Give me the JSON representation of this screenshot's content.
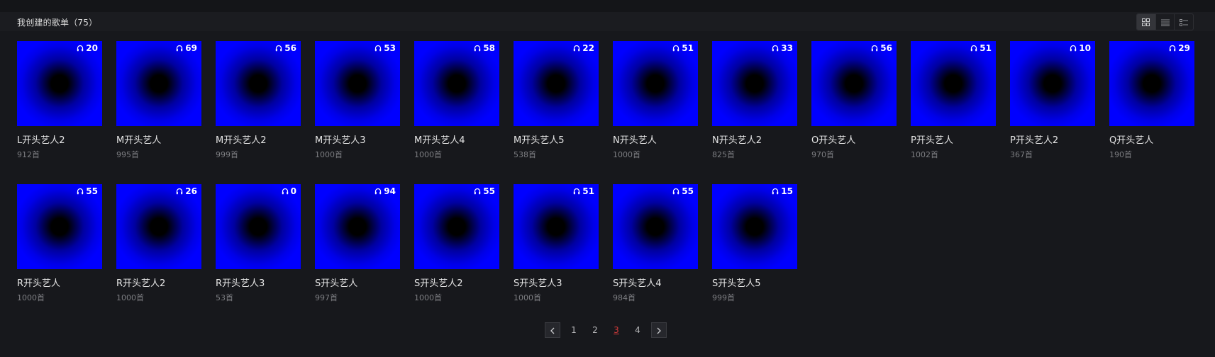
{
  "header": {
    "title": "我创建的歌单（75）"
  },
  "view_modes": [
    {
      "icon": "grid-view-icon",
      "active": true
    },
    {
      "icon": "list-view-icon",
      "active": false
    },
    {
      "icon": "detail-list-view-icon",
      "active": false
    }
  ],
  "playlists": [
    {
      "name": "L开头艺人2",
      "count": "912首",
      "plays": "20"
    },
    {
      "name": "M开头艺人",
      "count": "995首",
      "plays": "69"
    },
    {
      "name": "M开头艺人2",
      "count": "999首",
      "plays": "56"
    },
    {
      "name": "M开头艺人3",
      "count": "1000首",
      "plays": "53"
    },
    {
      "name": "M开头艺人4",
      "count": "1000首",
      "plays": "58"
    },
    {
      "name": "M开头艺人5",
      "count": "538首",
      "plays": "22"
    },
    {
      "name": "N开头艺人",
      "count": "1000首",
      "plays": "51"
    },
    {
      "name": "N开头艺人2",
      "count": "825首",
      "plays": "33"
    },
    {
      "name": "O开头艺人",
      "count": "970首",
      "plays": "56"
    },
    {
      "name": "P开头艺人",
      "count": "1002首",
      "plays": "51"
    },
    {
      "name": "P开头艺人2",
      "count": "367首",
      "plays": "10"
    },
    {
      "name": "Q开头艺人",
      "count": "190首",
      "plays": "29"
    },
    {
      "name": "R开头艺人",
      "count": "1000首",
      "plays": "55"
    },
    {
      "name": "R开头艺人2",
      "count": "1000首",
      "plays": "26"
    },
    {
      "name": "R开头艺人3",
      "count": "53首",
      "plays": "0"
    },
    {
      "name": "S开头艺人",
      "count": "997首",
      "plays": "94"
    },
    {
      "name": "S开头艺人2",
      "count": "1000首",
      "plays": "55"
    },
    {
      "name": "S开头艺人3",
      "count": "1000首",
      "plays": "51"
    },
    {
      "name": "S开头艺人4",
      "count": "984首",
      "plays": "55"
    },
    {
      "name": "S开头艺人5",
      "count": "999首",
      "plays": "15"
    }
  ],
  "pagination": {
    "pages": [
      "1",
      "2",
      "3",
      "4"
    ],
    "current": "3"
  },
  "colors": {
    "background": "#17181c",
    "cover_blue": "#0000ff",
    "current_page": "#d23a3a"
  }
}
